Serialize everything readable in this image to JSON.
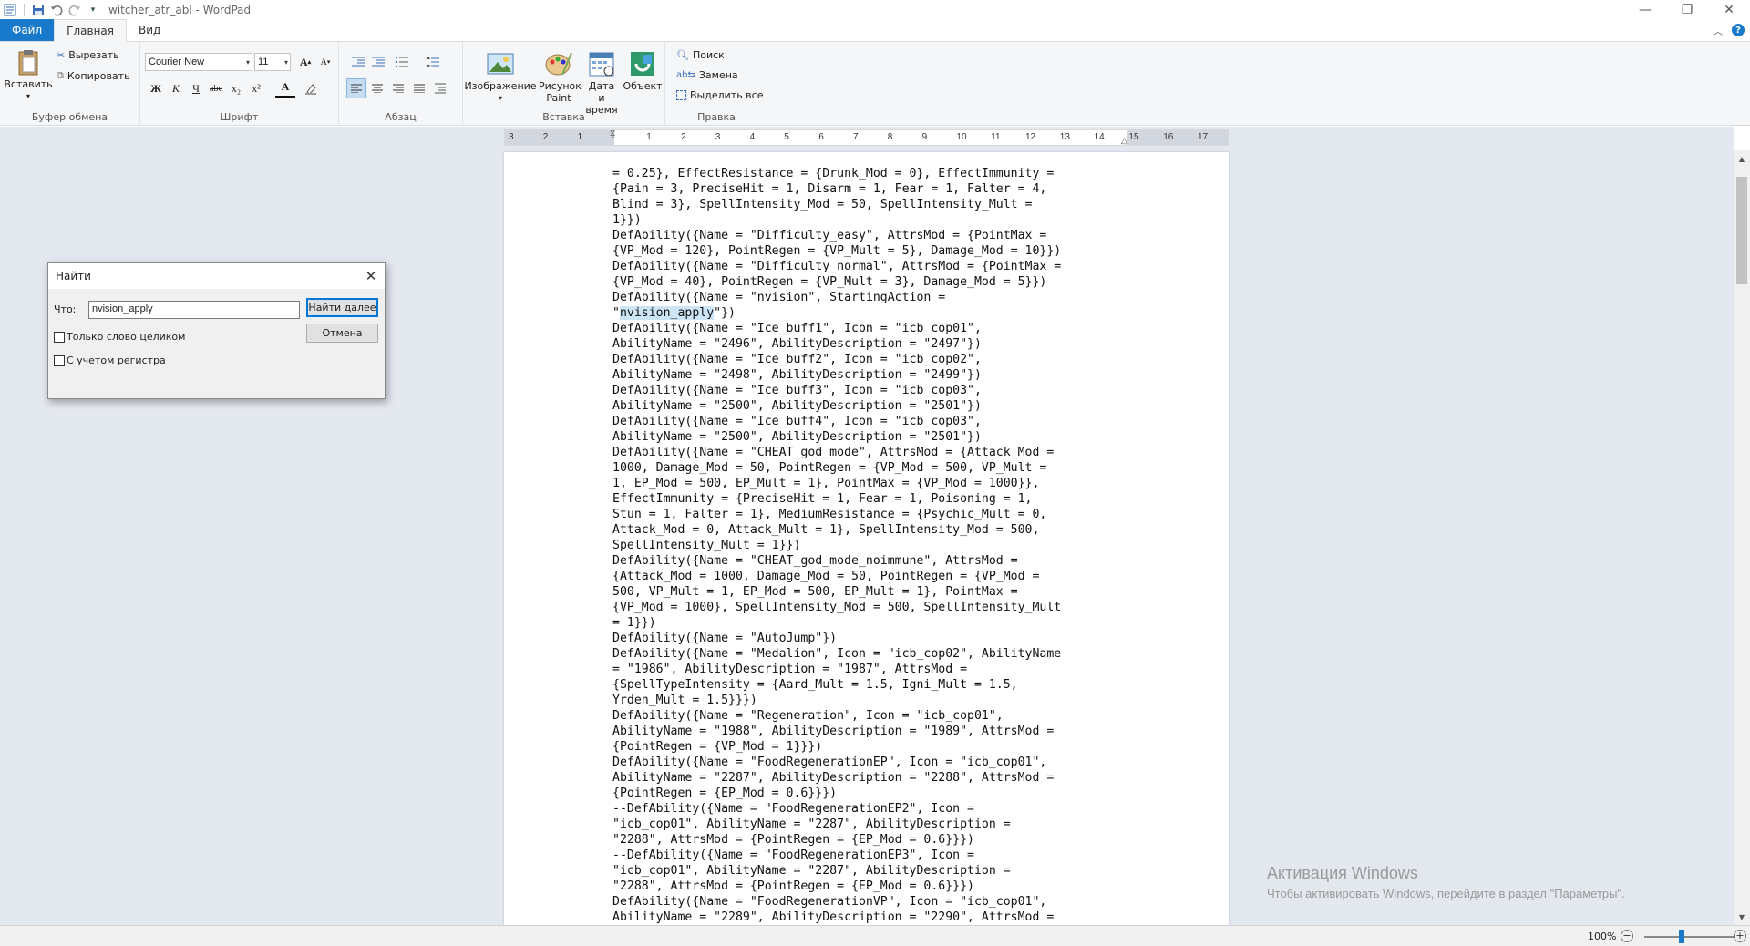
{
  "window": {
    "title": "witcher_atr_abl - WordPad"
  },
  "tabs": {
    "file": "Файл",
    "home": "Главная",
    "view": "Вид"
  },
  "ribbon": {
    "clipboard": {
      "paste": "Вставить",
      "cut": "Вырезать",
      "copy": "Копировать",
      "label": "Буфер обмена"
    },
    "font": {
      "family": "Courier New",
      "size": "11",
      "label": "Шрифт",
      "bold": "Ж",
      "italic": "К",
      "underline": "Ч",
      "strike": "abc",
      "sub": "x₂",
      "sup": "x²",
      "color": "A"
    },
    "paragraph": {
      "label": "Абзац"
    },
    "insert": {
      "image": "Изображение",
      "paint": "Рисунок Paint",
      "datetime": "Дата и время",
      "object": "Объект",
      "label": "Вставка"
    },
    "edit": {
      "find": "Поиск",
      "replace": "Замена",
      "select_all": "Выделить все",
      "label": "Правка"
    }
  },
  "ruler": {
    "ticks": [
      "3",
      "2",
      "1",
      "",
      "1",
      "2",
      "3",
      "4",
      "5",
      "6",
      "7",
      "8",
      "9",
      "10",
      "11",
      "12",
      "13",
      "14",
      "15",
      "16",
      "17"
    ]
  },
  "document": {
    "lines": [
      "= 0.25}, EffectResistance = {Drunk_Mod = 0}, EffectImmunity =",
      "{Pain = 3, PreciseHit = 1, Disarm = 1, Fear = 1, Falter = 4,",
      "Blind = 3}, SpellIntensity_Mod = 50, SpellIntensity_Mult =",
      "1}})",
      "DefAbility({Name = \"Difficulty_easy\", AttrsMod = {PointMax =",
      "{VP_Mod = 120}, PointRegen = {VP_Mult = 5}, Damage_Mod = 10}})",
      "DefAbility({Name = \"Difficulty_normal\", AttrsMod = {PointMax =",
      "{VP_Mod = 40}, PointRegen = {VP_Mult = 3}, Damage_Mod = 5}})",
      "DefAbility({Name = \"nvision\", StartingAction =",
      "HIGHLIGHT",
      "DefAbility({Name = \"Ice_buff1\", Icon = \"icb_cop01\",",
      "AbilityName = \"2496\", AbilityDescription = \"2497\"})",
      "DefAbility({Name = \"Ice_buff2\", Icon = \"icb_cop02\",",
      "AbilityName = \"2498\", AbilityDescription = \"2499\"})",
      "DefAbility({Name = \"Ice_buff3\", Icon = \"icb_cop03\",",
      "AbilityName = \"2500\", AbilityDescription = \"2501\"})",
      "DefAbility({Name = \"Ice_buff4\", Icon = \"icb_cop03\",",
      "AbilityName = \"2500\", AbilityDescription = \"2501\"})",
      "DefAbility({Name = \"CHEAT_god_mode\", AttrsMod = {Attack_Mod =",
      "1000, Damage_Mod = 50, PointRegen = {VP_Mod = 500, VP_Mult =",
      "1, EP_Mod = 500, EP_Mult = 1}, PointMax = {VP_Mod = 1000}},",
      "EffectImmunity = {PreciseHit = 1, Fear = 1, Poisoning = 1,",
      "Stun = 1, Falter = 1}, MediumResistance = {Psychic_Mult = 0,",
      "Attack_Mod = 0, Attack_Mult = 1}, SpellIntensity_Mod = 500,",
      "SpellIntensity_Mult = 1}})",
      "DefAbility({Name = \"CHEAT_god_mode_noimmune\", AttrsMod =",
      "{Attack_Mod = 1000, Damage_Mod = 50, PointRegen = {VP_Mod =",
      "500, VP_Mult = 1, EP_Mod = 500, EP_Mult = 1}, PointMax =",
      "{VP_Mod = 1000}, SpellIntensity_Mod = 500, SpellIntensity_Mult",
      "= 1}})",
      "DefAbility({Name = \"AutoJump\"})",
      "DefAbility({Name = \"Medalion\", Icon = \"icb_cop02\", AbilityName",
      "= \"1986\", AbilityDescription = \"1987\", AttrsMod =",
      "{SpellTypeIntensity = {Aard_Mult = 1.5, Igni_Mult = 1.5,",
      "Yrden_Mult = 1.5}}})",
      "DefAbility({Name = \"Regeneration\", Icon = \"icb_cop01\",",
      "AbilityName = \"1988\", AbilityDescription = \"1989\", AttrsMod =",
      "{PointRegen = {VP_Mod = 1}}})",
      "DefAbility({Name = \"FoodRegenerationEP\", Icon = \"icb_cop01\",",
      "AbilityName = \"2287\", AbilityDescription = \"2288\", AttrsMod =",
      "{PointRegen = {EP_Mod = 0.6}}})",
      "--DefAbility({Name = \"FoodRegenerationEP2\", Icon =",
      "\"icb_cop01\", AbilityName = \"2287\", AbilityDescription =",
      "\"2288\", AttrsMod = {PointRegen = {EP_Mod = 0.6}}})",
      "--DefAbility({Name = \"FoodRegenerationEP3\", Icon =",
      "\"icb_cop01\", AbilityName = \"2287\", AbilityDescription =",
      "\"2288\", AttrsMod = {PointRegen = {EP_Mod = 0.6}}})",
      "DefAbility({Name = \"FoodRegenerationVP\", Icon = \"icb_cop01\",",
      "AbilityName = \"2289\", AbilityDescription = \"2290\", AttrsMod ="
    ],
    "highlight_line": {
      "pre": "\"",
      "match": "nvision_apply",
      "post": "\"})"
    }
  },
  "find_dialog": {
    "title": "Найти",
    "what_label": "Что:",
    "query": "nvision_apply",
    "find_next": "Найти далее",
    "cancel": "Отмена",
    "whole_word": "Только слово целиком",
    "match_case": "С учетом регистра"
  },
  "status": {
    "zoom": "100%"
  },
  "watermark": {
    "title": "Активация Windows",
    "text": "Чтобы активировать Windows, перейдите в раздел \"Параметры\"."
  }
}
